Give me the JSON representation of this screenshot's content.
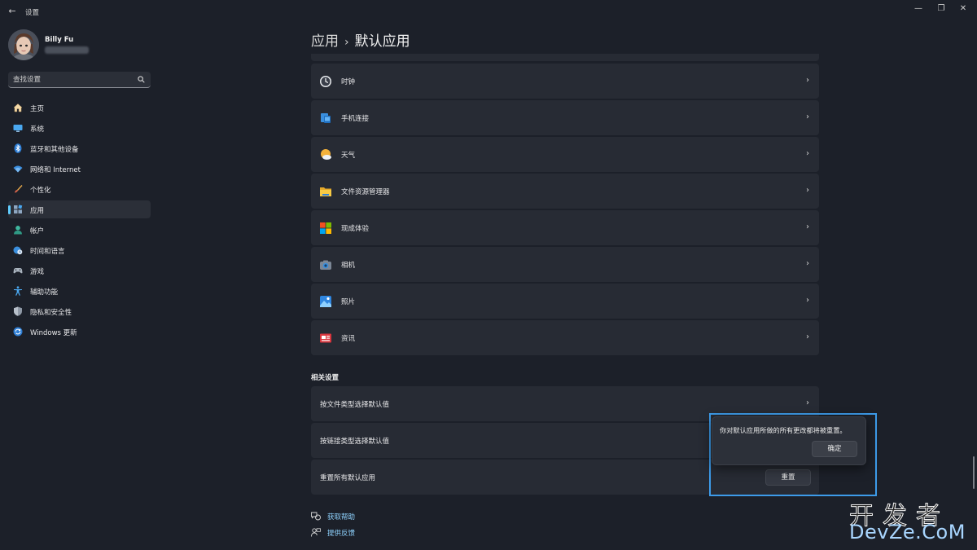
{
  "window": {
    "app_title": "设置",
    "back_glyph": "←",
    "minimize_glyph": "—",
    "maximize_glyph": "❐",
    "close_glyph": "✕"
  },
  "user": {
    "name": "Billy Fu"
  },
  "search": {
    "placeholder": "查找设置"
  },
  "sidebar": {
    "items": [
      {
        "label": "主页",
        "icon": "home-icon"
      },
      {
        "label": "系统",
        "icon": "monitor-icon"
      },
      {
        "label": "蓝牙和其他设备",
        "icon": "bluetooth-icon"
      },
      {
        "label": "网络和 Internet",
        "icon": "wifi-icon"
      },
      {
        "label": "个性化",
        "icon": "brush-icon"
      },
      {
        "label": "应用",
        "icon": "apps-icon",
        "active": true
      },
      {
        "label": "帐户",
        "icon": "person-icon"
      },
      {
        "label": "时间和语言",
        "icon": "globe-clock-icon"
      },
      {
        "label": "游戏",
        "icon": "gamepad-icon"
      },
      {
        "label": "辅助功能",
        "icon": "accessibility-icon"
      },
      {
        "label": "隐私和安全性",
        "icon": "shield-icon"
      },
      {
        "label": "Windows 更新",
        "icon": "update-icon"
      }
    ]
  },
  "breadcrumb": {
    "parent": "应用",
    "separator": "›",
    "current": "默认应用"
  },
  "apps": [
    {
      "label": "时钟",
      "icon": "clock-icon"
    },
    {
      "label": "手机连接",
      "icon": "phone-link-icon"
    },
    {
      "label": "天气",
      "icon": "weather-icon"
    },
    {
      "label": "文件资源管理器",
      "icon": "folder-icon"
    },
    {
      "label": "现成体验",
      "icon": "microsoft-logo-icon"
    },
    {
      "label": "相机",
      "icon": "camera-icon"
    },
    {
      "label": "照片",
      "icon": "photos-icon"
    },
    {
      "label": "资讯",
      "icon": "news-icon"
    }
  ],
  "chevron": "›",
  "related": {
    "title": "相关设置",
    "items": [
      {
        "label": "按文件类型选择默认值"
      },
      {
        "label": "按链接类型选择默认值"
      },
      {
        "label": "重置所有默认应用"
      }
    ],
    "reset_button": "重置"
  },
  "help": {
    "get_help": "获取帮助",
    "feedback": "提供反馈"
  },
  "flyout": {
    "message": "你对默认应用所做的所有更改都将被重置。",
    "ok_button": "确定"
  },
  "watermark": {
    "line1": "开发者",
    "line2": "DevZe.CoM"
  },
  "colors": {
    "accent": "#60cdff",
    "highlight_frame": "#3d9be9",
    "background": "#1c2029",
    "card": "#272b34"
  }
}
